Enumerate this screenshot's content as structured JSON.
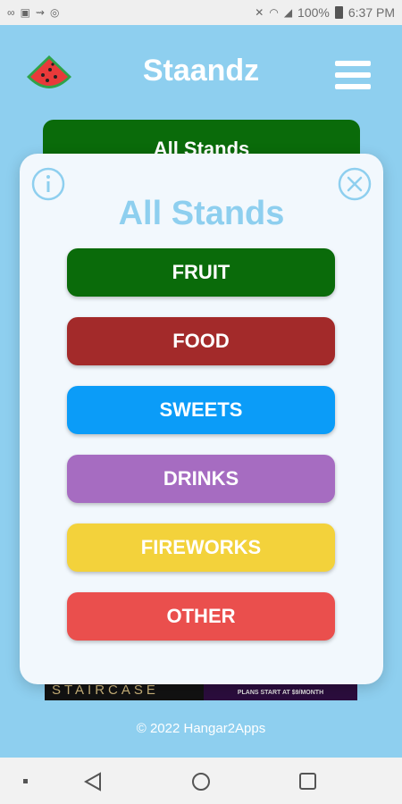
{
  "status_bar": {
    "battery": "100%",
    "time": "6:37 PM"
  },
  "header": {
    "title": "Staandz"
  },
  "background_button": {
    "label": "All Stands"
  },
  "modal": {
    "title": "All Stands",
    "categories": [
      {
        "label": "FRUIT",
        "color": "#0a6b0a"
      },
      {
        "label": "FOOD",
        "color": "#a32a2a"
      },
      {
        "label": "SWEETS",
        "color": "#0b9cf8"
      },
      {
        "label": "DRINKS",
        "color": "#a66cc1"
      },
      {
        "label": "FIREWORKS",
        "color": "#f3d23b"
      },
      {
        "label": "OTHER",
        "color": "#ea4f4d"
      }
    ]
  },
  "ad": {
    "left_text": "THE STAIRCASE",
    "right_text": "PLANS START AT $9/MONTH"
  },
  "footer": {
    "copyright": "© 2022 Hangar2Apps"
  },
  "colors": {
    "background": "#8ecfef",
    "title_accent": "#8ecfef"
  }
}
